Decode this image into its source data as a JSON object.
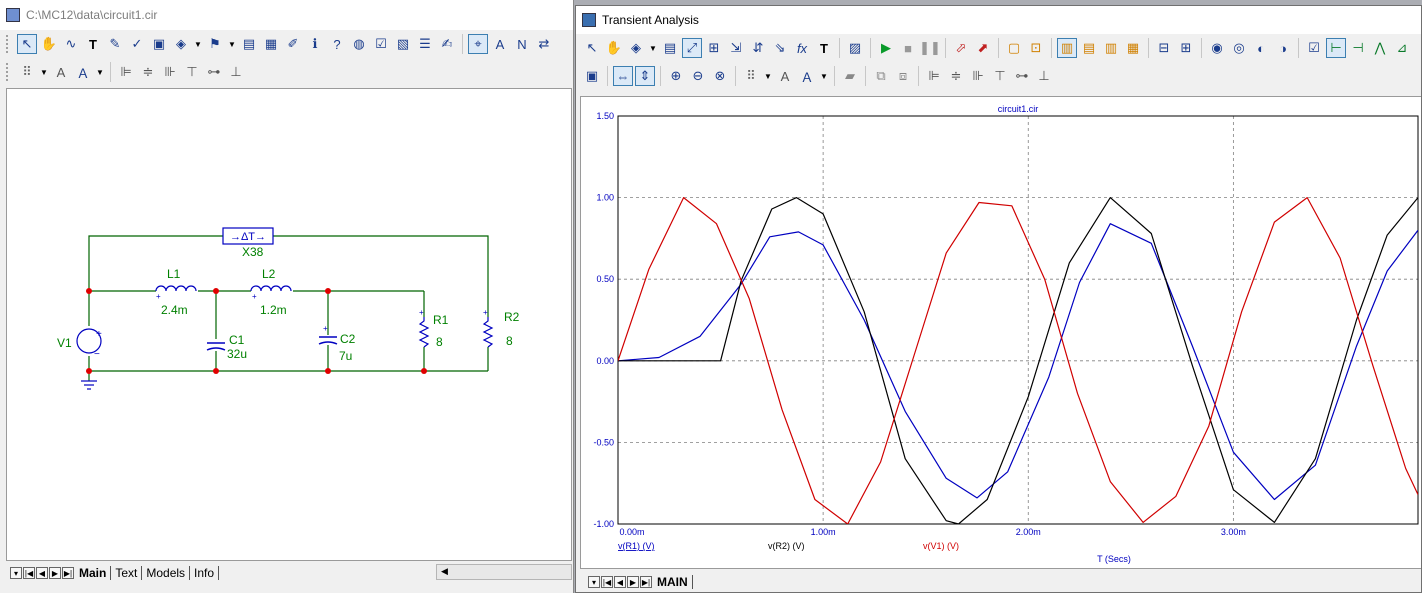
{
  "left_window": {
    "title": "C:\\MC12\\data\\circuit1.cir",
    "tabs": [
      "Main",
      "Text",
      "Models",
      "Info"
    ],
    "active_tab": "Main"
  },
  "right_window": {
    "title": "Transient Analysis",
    "tabs": [
      "MAIN"
    ],
    "active_tab": "MAIN"
  },
  "schematic": {
    "components": {
      "X38": "X38",
      "x38_symbol": "→ΔT→",
      "L1": "L1",
      "L1_value": "2.4m",
      "L2": "L2",
      "L2_value": "1.2m",
      "C1": "C1",
      "C1_value": "32u",
      "C2": "C2",
      "C2_value": "7u",
      "R1": "R1",
      "R1_value": "8",
      "R2": "R2",
      "R2_value": "8",
      "V1": "V1"
    },
    "wire_color": "#006400",
    "component_color": "#0000c0",
    "node_color": "#e00000"
  },
  "chart_data": {
    "type": "line",
    "title": "circuit1.cir",
    "xlabel": "T (Secs)",
    "xlim": [
      0,
      3.9
    ],
    "ylim": [
      -1.0,
      1.5
    ],
    "x_tick_labels": [
      "0.00m",
      "1.00m",
      "2.00m",
      "3.00m"
    ],
    "x_ticks": [
      0,
      1,
      2,
      3
    ],
    "y_tick_labels": [
      "1.50",
      "1.00",
      "0.50",
      "0.00",
      "-0.50",
      "-1.00"
    ],
    "y_ticks": [
      1.5,
      1.0,
      0.5,
      0.0,
      -0.5,
      -1.0
    ],
    "grid": true,
    "series": [
      {
        "name": "v(R1) (V)",
        "color": "#0000c0",
        "x": [
          0,
          0.2,
          0.4,
          0.6,
          0.74,
          0.88,
          1.0,
          1.2,
          1.4,
          1.6,
          1.75,
          1.9,
          2.1,
          2.25,
          2.4,
          2.6,
          2.8,
          3.0,
          3.2,
          3.4,
          3.6,
          3.75,
          3.9
        ],
        "y": [
          0,
          0.02,
          0.15,
          0.47,
          0.76,
          0.79,
          0.71,
          0.25,
          -0.31,
          -0.72,
          -0.84,
          -0.68,
          -0.1,
          0.48,
          0.84,
          0.72,
          0.09,
          -0.56,
          -0.85,
          -0.64,
          0.09,
          0.55,
          0.8
        ]
      },
      {
        "name": "v(R2) (V)",
        "color": "#000000",
        "x": [
          0,
          0.5,
          0.6,
          0.75,
          0.87,
          1.0,
          1.2,
          1.4,
          1.6,
          1.66,
          1.8,
          2.0,
          2.2,
          2.4,
          2.6,
          2.8,
          3.0,
          3.2,
          3.4,
          3.6,
          3.75,
          3.9
        ],
        "y": [
          0,
          0,
          0.49,
          0.93,
          1.0,
          0.9,
          0.3,
          -0.6,
          -0.98,
          -1.0,
          -0.85,
          -0.22,
          0.6,
          1.0,
          0.78,
          -0.03,
          -0.79,
          -0.99,
          -0.6,
          0.25,
          0.77,
          1.0
        ]
      },
      {
        "name": "v(V1) (V)",
        "color": "#d00000",
        "x": [
          0,
          0.15,
          0.32,
          0.48,
          0.64,
          0.8,
          0.96,
          1.12,
          1.28,
          1.44,
          1.6,
          1.76,
          1.92,
          2.08,
          2.24,
          2.4,
          2.56,
          2.72,
          2.88,
          3.04,
          3.2,
          3.36,
          3.52,
          3.68,
          3.84,
          3.9
        ],
        "y": [
          0,
          0.56,
          1.0,
          0.84,
          0.38,
          -0.3,
          -0.85,
          -1.0,
          -0.62,
          0.02,
          0.66,
          0.97,
          0.95,
          0.5,
          -0.2,
          -0.74,
          -0.99,
          -0.83,
          -0.4,
          0.3,
          0.85,
          1.0,
          0.63,
          -0.03,
          -0.66,
          -0.82
        ]
      }
    ]
  }
}
